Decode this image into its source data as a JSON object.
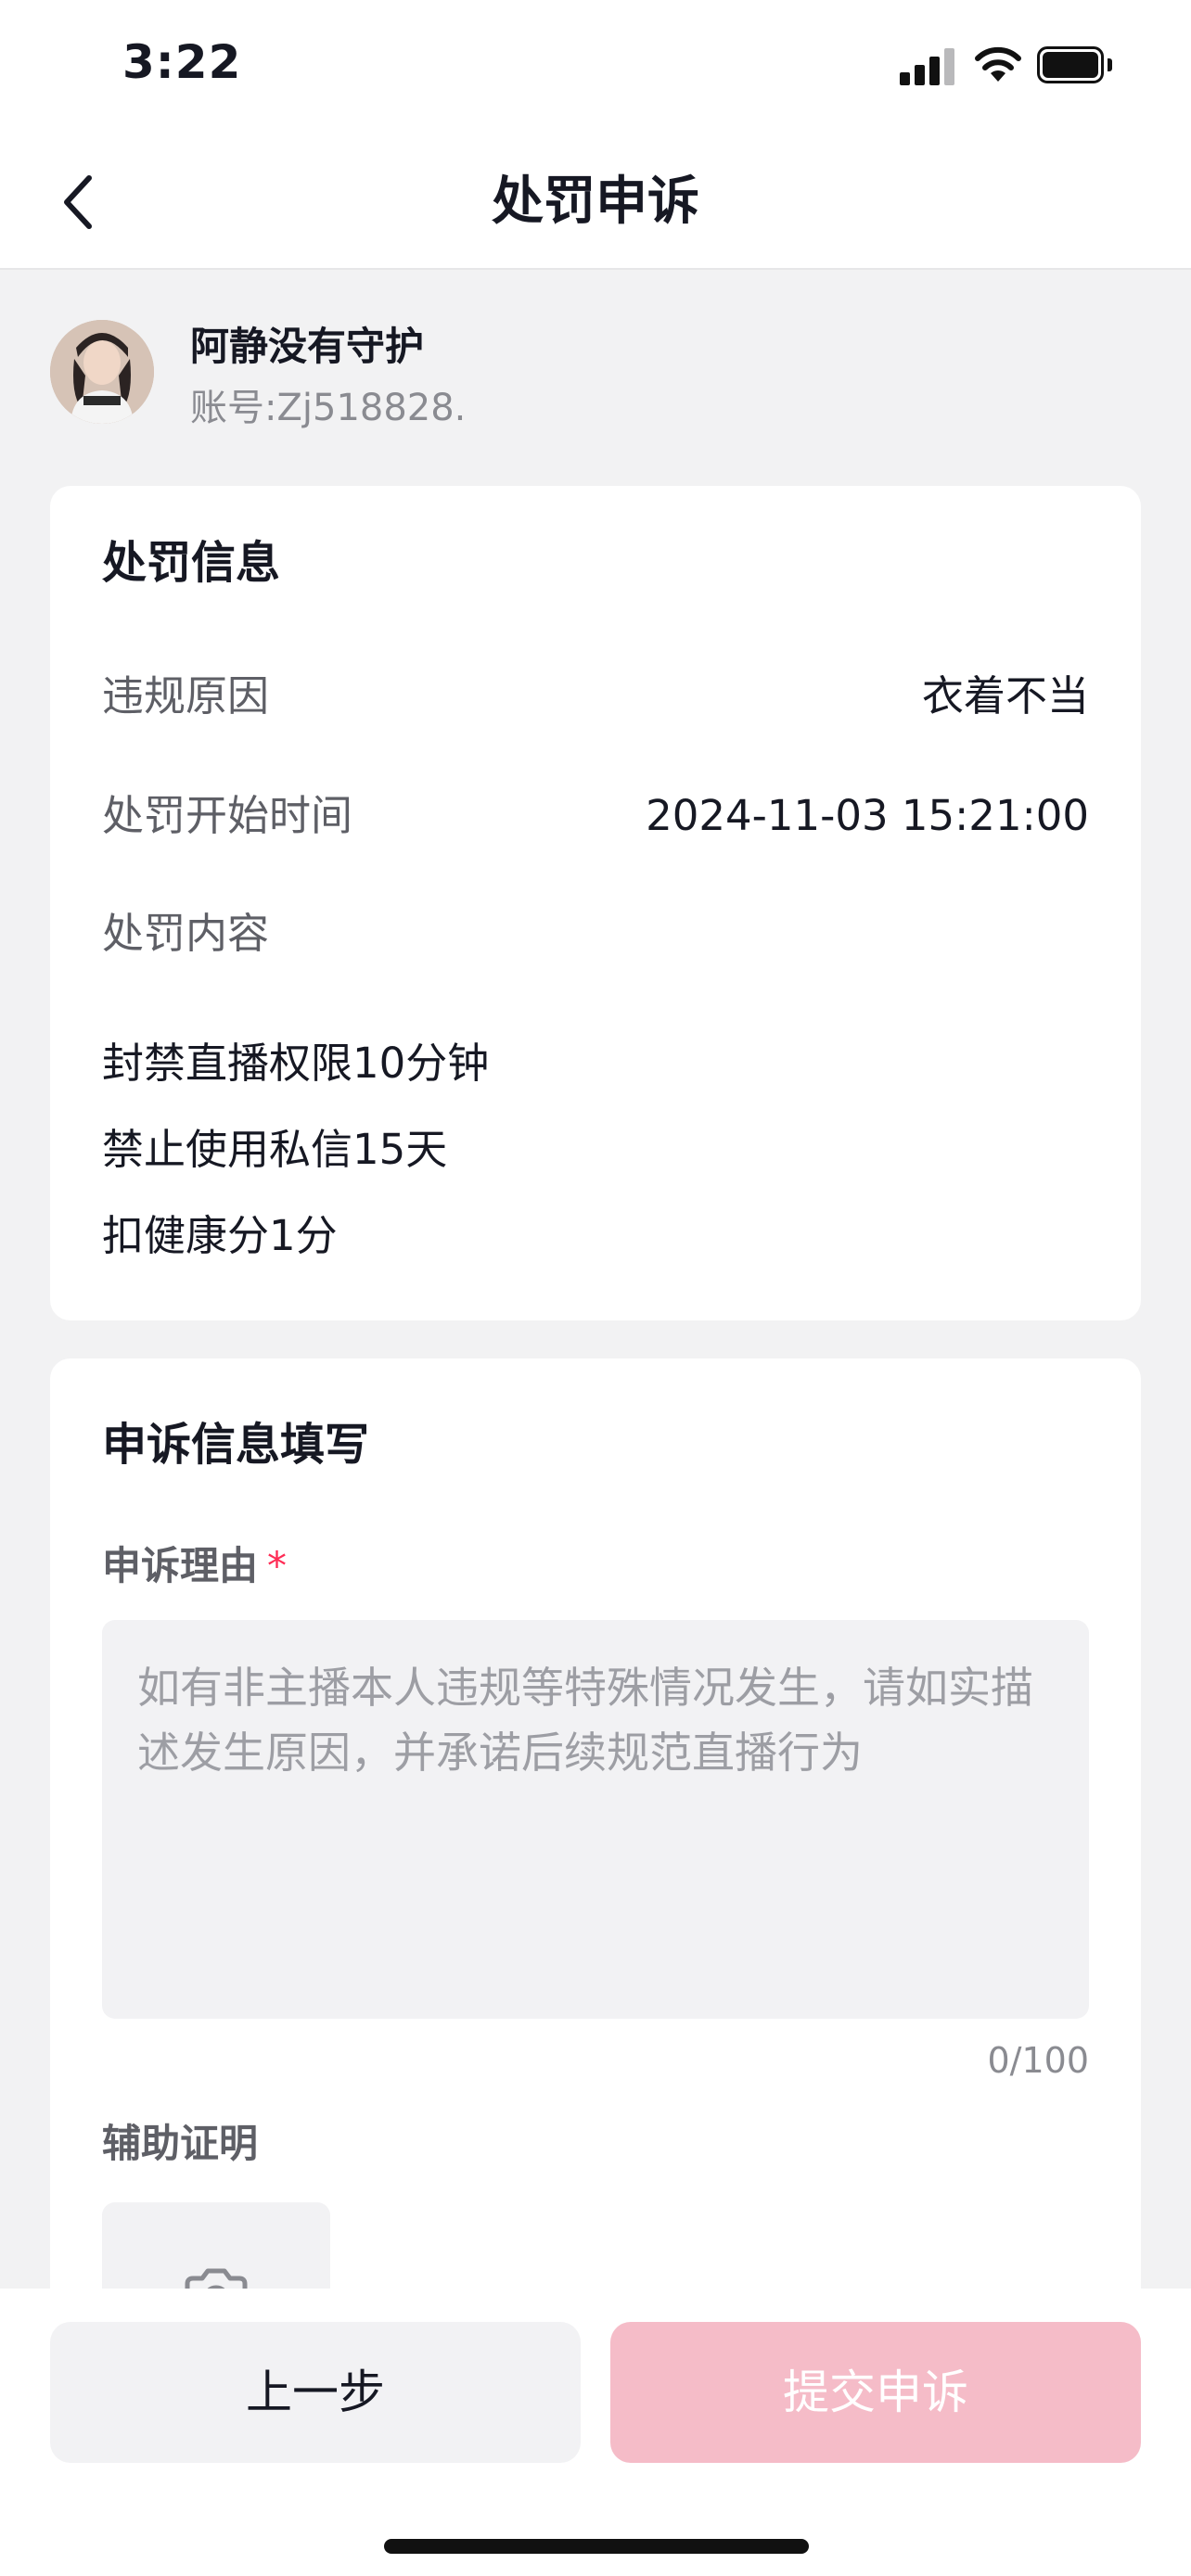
{
  "status_bar": {
    "time": "3:22"
  },
  "header": {
    "title": "处罚申诉"
  },
  "user": {
    "name": "阿静没有守护",
    "account": "账号:Zj518828."
  },
  "penalty_info": {
    "title": "处罚信息",
    "rows": [
      {
        "label": "违规原因",
        "value": "衣着不当"
      },
      {
        "label": "处罚开始时间",
        "value": "2024-11-03 15:21:00"
      },
      {
        "label": "处罚内容",
        "value": ""
      }
    ],
    "contents": [
      "封禁直播权限10分钟",
      "禁止使用私信15天",
      "扣健康分1分"
    ]
  },
  "appeal_form": {
    "title": "申诉信息填写",
    "reason_label": "申诉理由",
    "required_mark": "*",
    "reason_placeholder": "如有非主播本人违规等特殊情况发生，请如实描述发生原因，并承诺后续规范直播行为",
    "counter": "0/100",
    "evidence_label": "辅助证明"
  },
  "footer": {
    "prev_label": "上一步",
    "submit_label": "提交申诉"
  },
  "colors": {
    "accent": "#fe2c55",
    "submit_disabled": "#f5bcc8",
    "background": "#f2f2f3"
  }
}
